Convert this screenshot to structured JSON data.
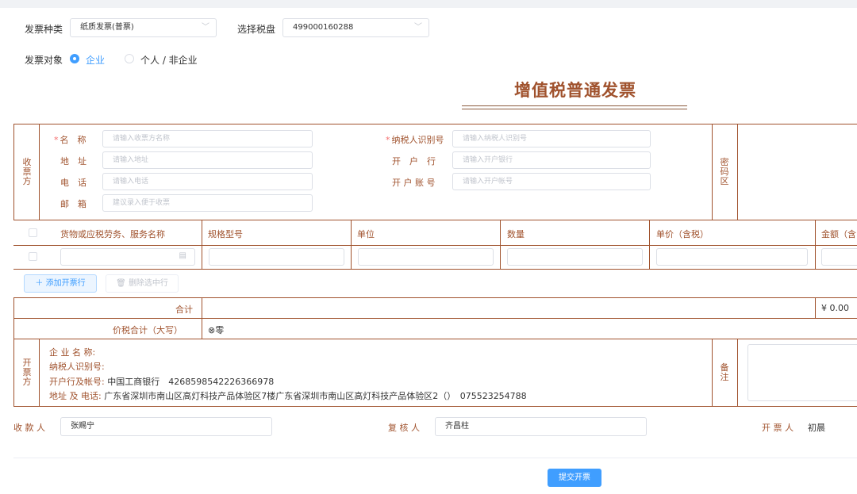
{
  "header": {
    "invoice_type_label": "发票种类",
    "invoice_type_value": "纸质发票(普票)",
    "tax_disk_label": "选择税盘",
    "tax_disk_value": "499000160288",
    "target_label": "发票对象",
    "target_options": [
      "企业",
      "个人 / 非企业"
    ],
    "target_selected": "企业"
  },
  "title": "增值税普通发票",
  "buyer": {
    "section_label": "收票方",
    "name_label": "名　称",
    "name_placeholder": "请输入收票方名称",
    "address_label": "地　址",
    "address_placeholder": "请输入地址",
    "phone_label": "电　话",
    "phone_placeholder": "请输入电话",
    "email_label": "邮　箱",
    "email_placeholder": "建议录入便于收票",
    "taxid_label": "纳税人识别号",
    "taxid_placeholder": "请输入纳税人识别号",
    "bank_label": "开　户　行",
    "bank_placeholder": "请输入开户银行",
    "account_label": "开 户 账 号",
    "account_placeholder": "请输入开户帐号",
    "cipher_label": "密码区"
  },
  "items_table": {
    "headers": [
      "货物或应税劳务、服务名称",
      "规格型号",
      "单位",
      "数量",
      "单价（含税）",
      "金额（含"
    ]
  },
  "actions": {
    "add_row": "添加开票行",
    "delete_row": "删除选中行"
  },
  "totals": {
    "sum_label": "合计",
    "sum_value": "¥ 0.00",
    "capital_label": "价税合计（大写）",
    "capital_value": "零"
  },
  "seller": {
    "section_label": "开票方",
    "company_label": "企 业 名 称:",
    "taxid_label": "纳税人识别号:",
    "bank_label": "开户行及帐号:",
    "bank_value": "中国工商银行　4268598542226366978",
    "address_label": "地址 及 电话:",
    "address_value": "广东省深圳市南山区高灯科技产品体验区7楼广东省深圳市南山区高灯科技产品体验区2（）　075523254788",
    "remark_label": "备注"
  },
  "signers": {
    "payee_label": "收 款 人",
    "payee_value": "张赐宁",
    "reviewer_label": "复 核 人",
    "reviewer_value": "齐昌柱",
    "drawer_label": "开 票 人",
    "drawer_value": "初晨"
  },
  "submit_label": "提交开票",
  "colors": {
    "accent": "#409eff",
    "invoice_brown": "#a0522d"
  }
}
